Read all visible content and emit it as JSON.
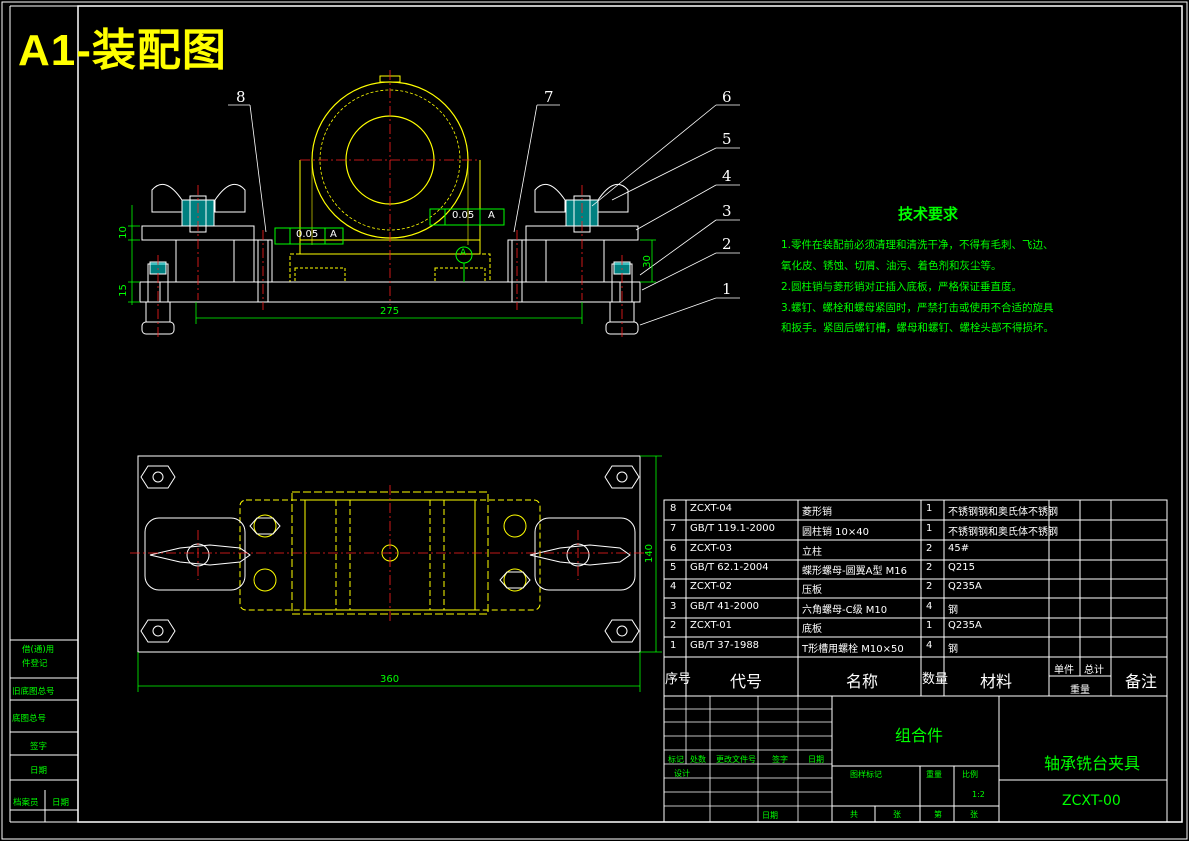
{
  "title": "A1-装配图",
  "balloons": [
    "8",
    "7",
    "6",
    "5",
    "4",
    "3",
    "2",
    "1"
  ],
  "dims": {
    "width_top": "275",
    "width_bottom": "360",
    "height_plan": "140",
    "left_upper": "10",
    "left_lower": "15",
    "right": "30"
  },
  "tolerances": {
    "perp": "0.05",
    "perp_ref": "A",
    "par": "0.05",
    "par_ref": "A",
    "datum": "A"
  },
  "tech": {
    "title": "技术要求",
    "lines": [
      "1.零件在装配前必须清理和清洗干净，不得有毛刺、飞边、",
      "氧化皮、锈蚀、切屑、油污、着色剂和灰尘等。",
      "2.圆柱销与菱形销对正插入底板，严格保证垂直度。",
      "3.螺钉、螺栓和螺母紧固时，严禁打击或使用不合适的旋具",
      "和扳手。紧固后螺钉槽，螺母和螺钉、螺栓头部不得损坏。"
    ]
  },
  "bom": {
    "rows": [
      {
        "no": "8",
        "code": "ZCXT-04",
        "name": "菱形销",
        "qty": "1",
        "material": "不锈钢钢和奥氏体不锈钢"
      },
      {
        "no": "7",
        "code": "GB/T 119.1-2000",
        "name": "圆柱销 10×40",
        "qty": "1",
        "material": "不锈钢钢和奥氏体不锈钢"
      },
      {
        "no": "6",
        "code": "ZCXT-03",
        "name": "立柱",
        "qty": "2",
        "material": "45#"
      },
      {
        "no": "5",
        "code": "GB/T 62.1-2004",
        "name": "蝶形螺母-圆翼A型 M16",
        "qty": "2",
        "material": "Q215"
      },
      {
        "no": "4",
        "code": "ZCXT-02",
        "name": "压板",
        "qty": "2",
        "material": "Q235A"
      },
      {
        "no": "3",
        "code": "GB/T 41-2000",
        "name": "六角螺母-C级 M10",
        "qty": "4",
        "material": "钢"
      },
      {
        "no": "2",
        "code": "ZCXT-01",
        "name": "底板",
        "qty": "1",
        "material": "Q235A"
      },
      {
        "no": "1",
        "code": "GB/T 37-1988",
        "name": "T形槽用螺栓 M10×50",
        "qty": "4",
        "material": "钢"
      }
    ],
    "header": {
      "no": "序号",
      "code": "代号",
      "name": "名称",
      "qty": "数量",
      "material": "材料",
      "unit": "单件",
      "total": "总计",
      "weight": "重量",
      "remark": "备注"
    }
  },
  "titleblock": {
    "assembly": "组合件",
    "product": "轴承铣台夹具",
    "drawing_no": "ZCXT-00",
    "labels": [
      "标记",
      "处数",
      "更改文件号",
      "签字",
      "日期"
    ],
    "design": "设计",
    "check": "日期",
    "stage_labels": [
      "图样标记",
      "重量",
      "比例"
    ],
    "scale": "1:2",
    "sheets": [
      "共",
      "张",
      "第",
      "张"
    ]
  },
  "sidebar": [
    "借(通)用",
    "件登记",
    "旧底图总号",
    "底图总号",
    "签字",
    "日期",
    "档案员",
    "日期"
  ]
}
